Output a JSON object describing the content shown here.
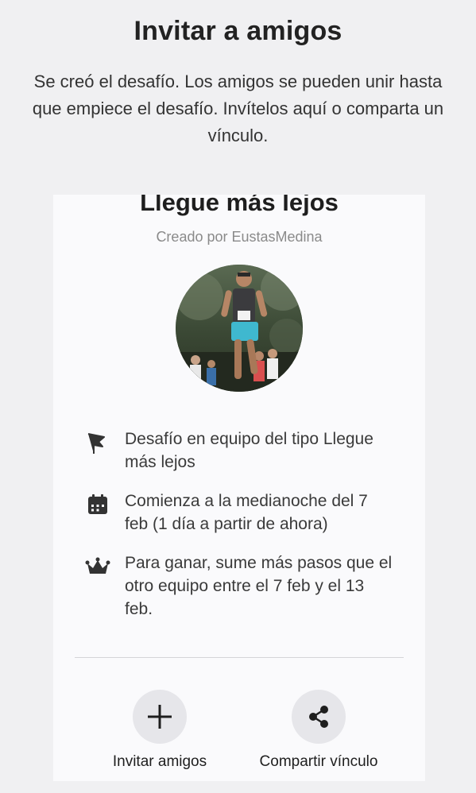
{
  "header": {
    "title": "Invitar a amigos",
    "description": "Se creó el desafío. Los amigos se pueden unir hasta que empiece el desafío. Invítelos aquí o comparta un vínculo."
  },
  "challenge": {
    "name": "Llegue más lejos",
    "creator": "Creado por EustasMedina",
    "details": [
      {
        "icon": "flag-icon",
        "text": "Desafío en equipo del tipo Llegue más lejos"
      },
      {
        "icon": "calendar-icon",
        "text": "Comienza a la medianoche del 7 feb (1 día a partir de ahora)"
      },
      {
        "icon": "crown-icon",
        "text": "Para ganar, sume más pasos que el otro equipo entre el 7 feb y el 13 feb."
      }
    ]
  },
  "actions": {
    "invite_label": "Invitar amigos",
    "share_label": "Compartir vínculo"
  },
  "colors": {
    "background": "#f0f0f2",
    "card": "#fafafc",
    "action_circle": "#e6e6ea",
    "icon": "#333333"
  }
}
